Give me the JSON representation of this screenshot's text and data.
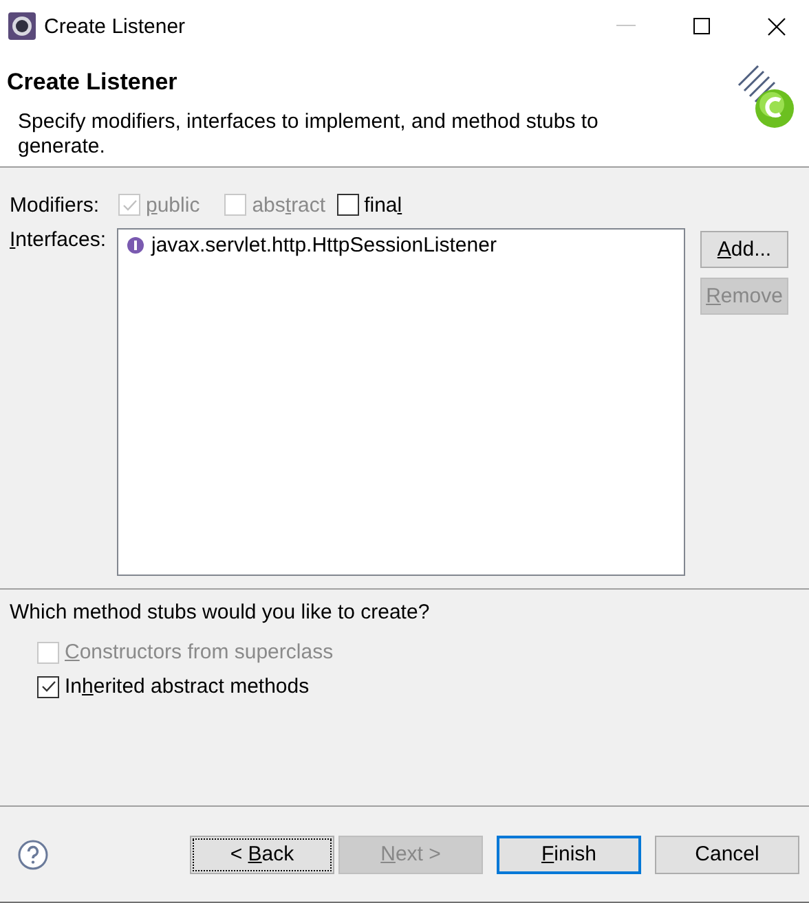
{
  "window": {
    "title": "Create Listener"
  },
  "header": {
    "title": "Create Listener",
    "description": "Specify modifiers, interfaces to implement, and method stubs to generate."
  },
  "modifiers": {
    "label": "Modifiers:",
    "options": [
      {
        "label": [
          {
            "text": "p",
            "underlined": true
          },
          {
            "text": "ublic",
            "underlined": false
          }
        ],
        "checked": true,
        "disabled": true
      },
      {
        "label": [
          {
            "text": "abs",
            "underlined": false
          },
          {
            "text": "t",
            "underlined": true
          },
          {
            "text": "ract",
            "underlined": false
          }
        ],
        "checked": false,
        "disabled": true
      },
      {
        "label": [
          {
            "text": "fina",
            "underlined": false
          },
          {
            "text": "l",
            "underlined": true
          }
        ],
        "checked": false,
        "disabled": false
      }
    ]
  },
  "interfaces": {
    "label": [
      {
        "text": "I",
        "underlined": true
      },
      {
        "text": "nterfaces:",
        "underlined": false
      }
    ],
    "items": [
      {
        "name": "javax.servlet.http.HttpSessionListener"
      }
    ],
    "buttons": [
      {
        "label": [
          {
            "text": "A",
            "underlined": true
          },
          {
            "text": "dd...",
            "underlined": false
          }
        ],
        "disabled": false
      },
      {
        "label": [
          {
            "text": "R",
            "underlined": true
          },
          {
            "text": "emove",
            "underlined": false
          }
        ],
        "disabled": true
      }
    ]
  },
  "stubs": {
    "question": "Which method stubs would you like to create?",
    "options": [
      {
        "label": [
          {
            "text": "C",
            "underlined": true
          },
          {
            "text": "onstructors from superclass",
            "underlined": false
          }
        ],
        "checked": false,
        "disabled": true
      },
      {
        "label": [
          {
            "text": "In",
            "underlined": false
          },
          {
            "text": "h",
            "underlined": true
          },
          {
            "text": "erited abstract methods",
            "underlined": false
          }
        ],
        "checked": true,
        "disabled": false
      }
    ]
  },
  "footer": {
    "buttons": [
      {
        "label": [
          {
            "text": "< ",
            "underlined": false
          },
          {
            "text": "B",
            "underlined": true
          },
          {
            "text": "ack",
            "underlined": false
          }
        ],
        "disabled": false,
        "focused": true,
        "default": false
      },
      {
        "label": [
          {
            "text": "N",
            "underlined": true
          },
          {
            "text": "ext >",
            "underlined": false
          }
        ],
        "disabled": true,
        "focused": false,
        "default": false
      },
      {
        "label": [
          {
            "text": "F",
            "underlined": true
          },
          {
            "text": "inish",
            "underlined": false
          }
        ],
        "disabled": false,
        "focused": false,
        "default": true
      },
      {
        "label": [
          {
            "text": "Cancel",
            "underlined": false
          }
        ],
        "disabled": false,
        "focused": false,
        "default": false
      }
    ]
  }
}
